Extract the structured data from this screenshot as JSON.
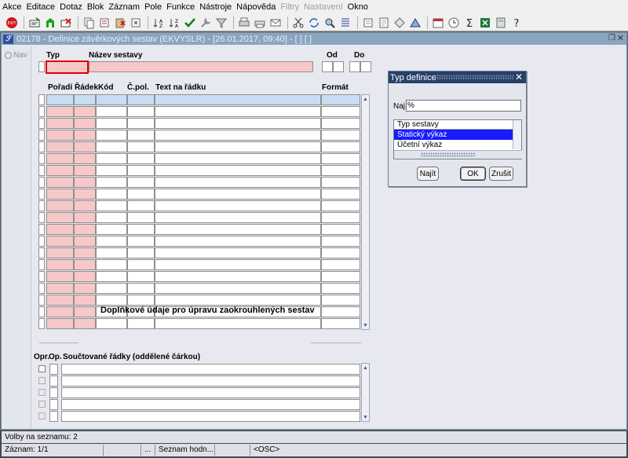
{
  "menu": [
    "Akce",
    "Editace",
    "Dotaz",
    "Blok",
    "Záznam",
    "Pole",
    "Funkce",
    "Nástroje",
    "Nápověda",
    "Filtry",
    "Nastavení",
    "Okno"
  ],
  "menu_disabled": [
    "Filtry",
    "Nastavení"
  ],
  "window": {
    "title": "02178 - Definice závěrkových sestav (EKVYSLR) - [26.01.2017, 09:40] - [ ] [ ]",
    "icon_label": "ℱ"
  },
  "nav": {
    "label": "Nav"
  },
  "header": {
    "typ_label": "Typ",
    "nazev_label": "Název sestavy",
    "od_label": "Od",
    "do_label": "Do"
  },
  "grid": {
    "columns": [
      "Pořadí",
      "Řádek",
      "Kód",
      "Č.pol.",
      "Text na řádku",
      "Formát"
    ],
    "row_count": 20
  },
  "section": {
    "title": "Doplňkové údaje pro úpravu zaokrouhlených sestav",
    "col_opr": "Opr.",
    "col_op": "Op.",
    "col_rows": "Součtované řádky (oddělené čárkou)",
    "row_count": 5
  },
  "dialog": {
    "title": "Typ definice",
    "find_label": "Najít",
    "find_value": "%",
    "list_header": "Typ sestavy",
    "items": [
      "Statický výkaz",
      "Účetní výkaz"
    ],
    "selected_index": 0,
    "btn_find": "Najít",
    "btn_ok": "OK",
    "btn_cancel": "Zrušit"
  },
  "status": {
    "line1": "Volby na seznamu: 2",
    "record": "Záznam: 1/1",
    "ellipsis": "...",
    "list_value": "Seznam hodn...",
    "osc": "<OSC>"
  },
  "toolbar_icons": [
    "exit-icon",
    "save-icon",
    "new-record-icon",
    "delete-record-icon",
    "copy-icon",
    "cut-icon",
    "paste-icon",
    "clear-icon",
    "sort-asc-icon",
    "sort-desc-icon",
    "check-icon",
    "tools-icon",
    "filter-icon",
    "print-icon",
    "print-preview-icon",
    "mail-icon",
    "scissors-icon",
    "refresh-icon",
    "zoom-icon",
    "list-icon",
    "first-icon",
    "doc-icon",
    "help-icon",
    "shape-icon",
    "calendar-icon",
    "clock-icon",
    "sum-icon",
    "excel-icon",
    "calc-icon",
    "question-icon"
  ]
}
